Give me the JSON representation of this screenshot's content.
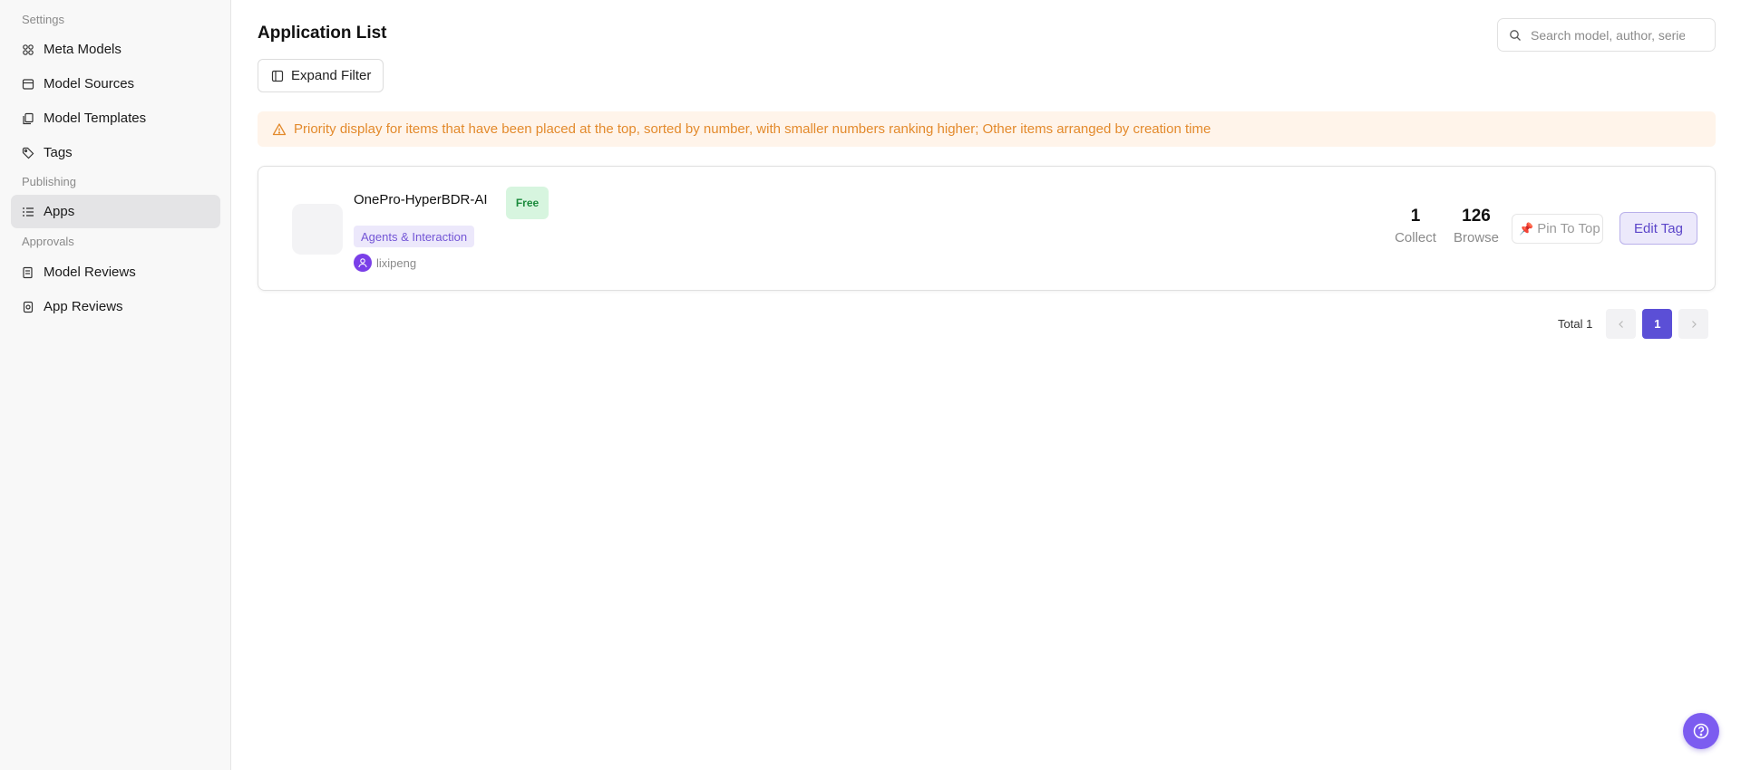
{
  "sidebar": {
    "sections": [
      {
        "label": "Settings"
      },
      {
        "label": "Publishing"
      },
      {
        "label": "Approvals"
      }
    ],
    "items": [
      {
        "label": "Meta Models",
        "icon": "grid-icon"
      },
      {
        "label": "Model Sources",
        "icon": "source-icon"
      },
      {
        "label": "Model Templates",
        "icon": "template-icon"
      },
      {
        "label": "Tags",
        "icon": "tag-icon"
      },
      {
        "label": "Apps",
        "icon": "list-icon",
        "active": true
      },
      {
        "label": "Model Reviews",
        "icon": "review-icon"
      },
      {
        "label": "App Reviews",
        "icon": "app-review-icon"
      }
    ]
  },
  "header": {
    "title": "Application List",
    "search_placeholder": "Search model, author, series"
  },
  "toolbar": {
    "expand_filter_label": "Expand Filter"
  },
  "notice": {
    "text": "Priority display for items that have been placed at the top, sorted by number, with smaller numbers ranking higher; Other items arranged by creation time"
  },
  "apps": [
    {
      "name": "OnePro-HyperBDR-AI",
      "price_badge": "Free",
      "tag": "Agents & Interaction",
      "author": "lixipeng",
      "collect_count": "1",
      "collect_label": "Collect",
      "browse_count": "126",
      "browse_label": "Browse",
      "pin_label": "Pin To Top",
      "edit_label": "Edit Tag"
    }
  ],
  "pagination": {
    "total_text": "Total 1",
    "current_page": "1",
    "prev_icon": "chevron-left-icon",
    "next_icon": "chevron-right-icon"
  },
  "colors": {
    "accent": "#5b4fd6",
    "notice_text": "#e38a2c",
    "notice_bg": "#fff4ea",
    "free_badge_bg": "#d7f5df",
    "tag_bg": "#ece8fb"
  }
}
